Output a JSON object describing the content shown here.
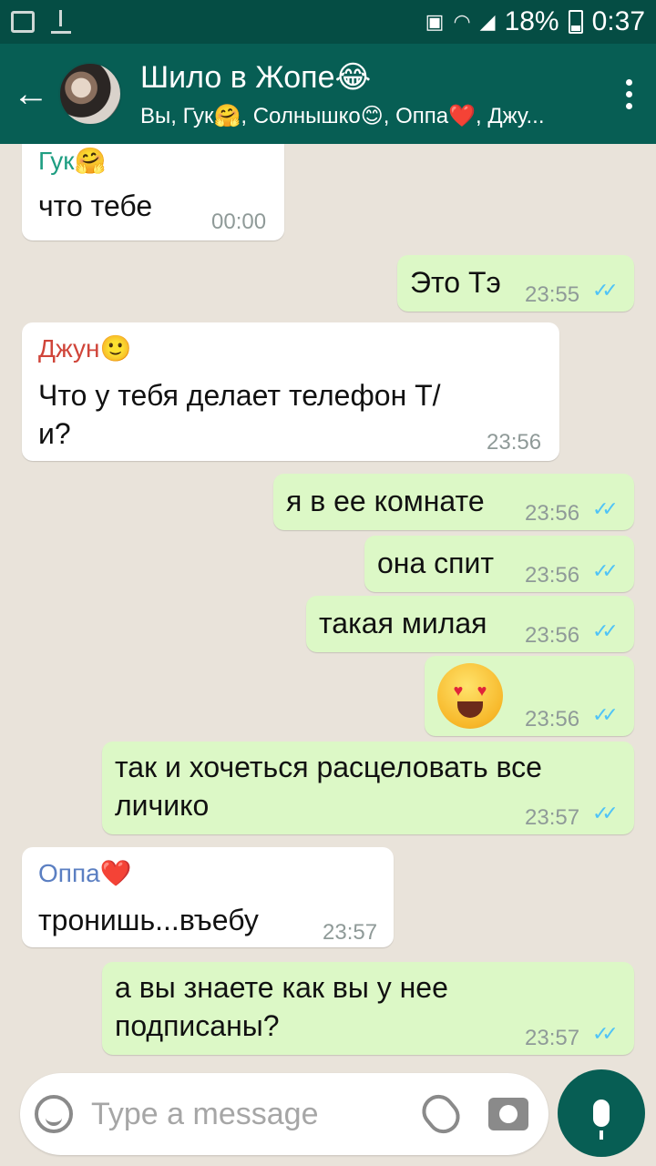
{
  "status": {
    "battery": "18%",
    "time": "0:37",
    "icons": [
      "image-icon",
      "download-icon",
      "device-icon",
      "wifi-icon",
      "signal-icon",
      "battery-icon"
    ]
  },
  "header": {
    "title": "Шило в Жопе😂",
    "subtitle": "Вы, Гук🤗, Солнышко😊, Оппа❤️, Джу..."
  },
  "messages": [
    {
      "dir": "in",
      "sender": "Гук🤗",
      "text": "что тебе",
      "time": "00:00"
    },
    {
      "dir": "out",
      "text": "Это Тэ",
      "time": "23:55"
    },
    {
      "dir": "in",
      "sender": "Джун🙂",
      "text": "Что у тебя делает телефон Т/",
      "text2": "и?",
      "time": "23:56"
    },
    {
      "dir": "out",
      "text": "я в ее комнате",
      "time": "23:56"
    },
    {
      "dir": "out",
      "text": "она спит",
      "time": "23:56"
    },
    {
      "dir": "out",
      "text": "такая милая",
      "time": "23:56"
    },
    {
      "dir": "out",
      "emoji": "heart-eyes-emoji",
      "time": "23:56"
    },
    {
      "dir": "out",
      "text": "так и хочеться расцеловать все",
      "text2": "личико",
      "time": "23:57"
    },
    {
      "dir": "in",
      "sender": "Оппа❤️",
      "text": "тронишь...въебу",
      "time": "23:57"
    },
    {
      "dir": "out",
      "text": "а вы знаете как вы у нее",
      "text2": "подписаны?",
      "time": "23:57"
    }
  ],
  "colors": {
    "header": "#075e54",
    "statusbar": "#054d44",
    "outgoing": "#dcf8c6",
    "incoming": "#ffffff",
    "sender_guk": "#1f9e82",
    "sender_jun": "#d0453a",
    "sender_oppa": "#5b7fc2",
    "ticks": "#4fc3f7"
  },
  "input": {
    "placeholder": "Type a message"
  }
}
